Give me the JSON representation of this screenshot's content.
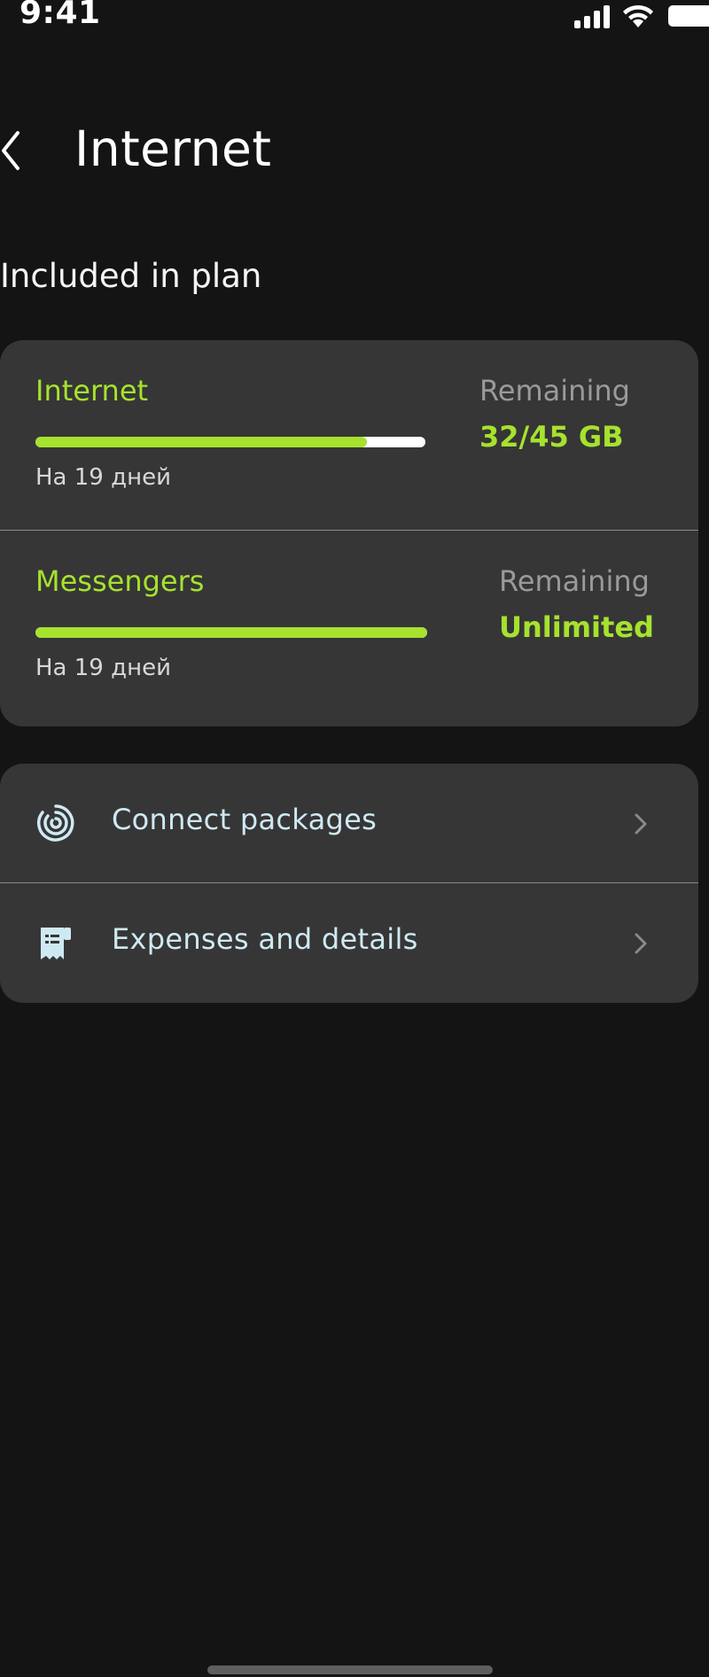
{
  "status_bar": {
    "time": "9:41"
  },
  "header": {
    "title": "Internet"
  },
  "section_title": "Included in plan",
  "plan_items": [
    {
      "name": "Internet",
      "period": "На 19 дней",
      "remaining_label": "Remaining",
      "remaining_value": "32/45 GB",
      "progress_fraction": 0.85
    },
    {
      "name": "Messengers",
      "period": "На 19 дней",
      "remaining_label": "Remaining",
      "remaining_value": "Unlimited",
      "progress_fraction": 1.0
    }
  ],
  "actions": [
    {
      "label": "Connect packages",
      "icon": "packages-icon"
    },
    {
      "label": "Expenses and details",
      "icon": "receipt-icon"
    }
  ],
  "colors": {
    "background": "#141414",
    "card": "#363636",
    "accent": "#a6e22e",
    "action_text": "#cfe9f2",
    "muted": "#9a9a9a"
  }
}
